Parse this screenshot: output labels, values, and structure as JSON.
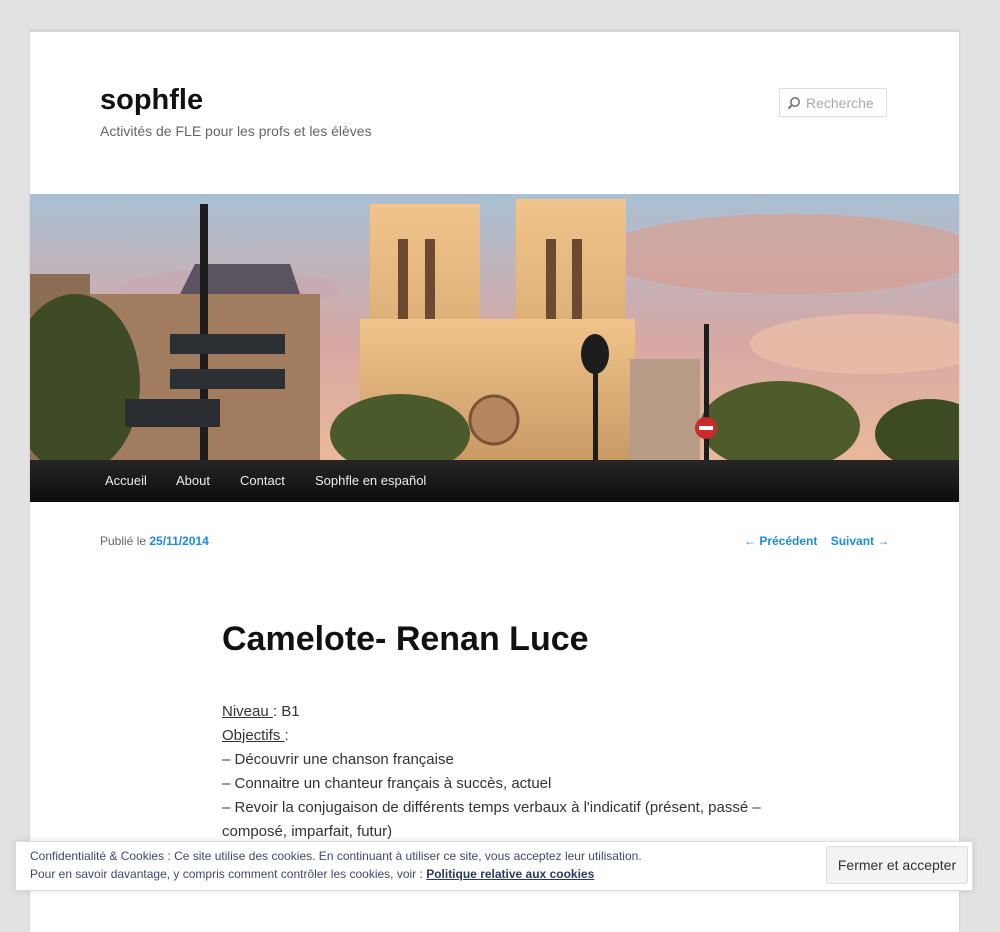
{
  "site": {
    "title": "sophfle",
    "description": "Activités de FLE pour les profs et les élèves"
  },
  "search": {
    "placeholder": "Recherche",
    "icon": "search-icon"
  },
  "banner": {
    "alt": "Notre-Dame de Paris",
    "icon": "banner-image"
  },
  "nav": {
    "items": [
      {
        "label": "Accueil"
      },
      {
        "label": "About"
      },
      {
        "label": "Contact"
      },
      {
        "label": "Sophfle en español"
      }
    ]
  },
  "meta": {
    "published_prefix": "Publié le",
    "date": "25/11/2014"
  },
  "post_nav": {
    "previous": "← Précédent",
    "next": "Suivant →"
  },
  "post": {
    "title": "Camelote- Renan Luce",
    "niveau_label": "Niveau ",
    "niveau_value": " : B1",
    "objectifs_label": "Objectifs ",
    "objectifs_suffix": ":",
    "objectives": [
      "– Découvrir une chanson française",
      "– Connaitre un chanteur français à succès, actuel",
      "– Revoir la conjugaison de différents temps verbaux à l'indicatif (présent, passé – composé, imparfait, futur)"
    ]
  },
  "cookie": {
    "line1": "Confidentialité & Cookies : Ce site utilise des cookies. En continuant à utiliser ce site, vous acceptez leur utilisation.",
    "line2": "Pour en savoir davantage, y compris comment contrôler les cookies, voir :",
    "link": "Politique relative aux cookies",
    "button": "Fermer et accepter"
  },
  "colors": {
    "link": "#1b8be0",
    "nav_bg": "#1a1a1a",
    "page_bg": "#e2e2e2"
  }
}
